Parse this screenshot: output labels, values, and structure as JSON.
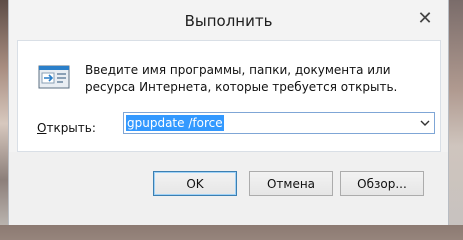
{
  "window": {
    "title": "Выполнить",
    "close_symbol": "✕"
  },
  "content": {
    "description": "Введите имя программы, папки, документа или ресурса Интернета, которые требуется открыть.",
    "open_label_accel": "О",
    "open_label_rest": "ткрыть:",
    "command_value": "gpupdate /force"
  },
  "buttons": {
    "ok": "OK",
    "cancel": "Отмена",
    "browse": "Обзор..."
  },
  "icons": {
    "run": "run-program-icon",
    "dropdown": "chevron-down-icon",
    "close": "close-icon"
  },
  "colors": {
    "selection": "#3399ff",
    "focus_border": "#7fa6d6",
    "default_button_border": "#3c7fb1"
  }
}
